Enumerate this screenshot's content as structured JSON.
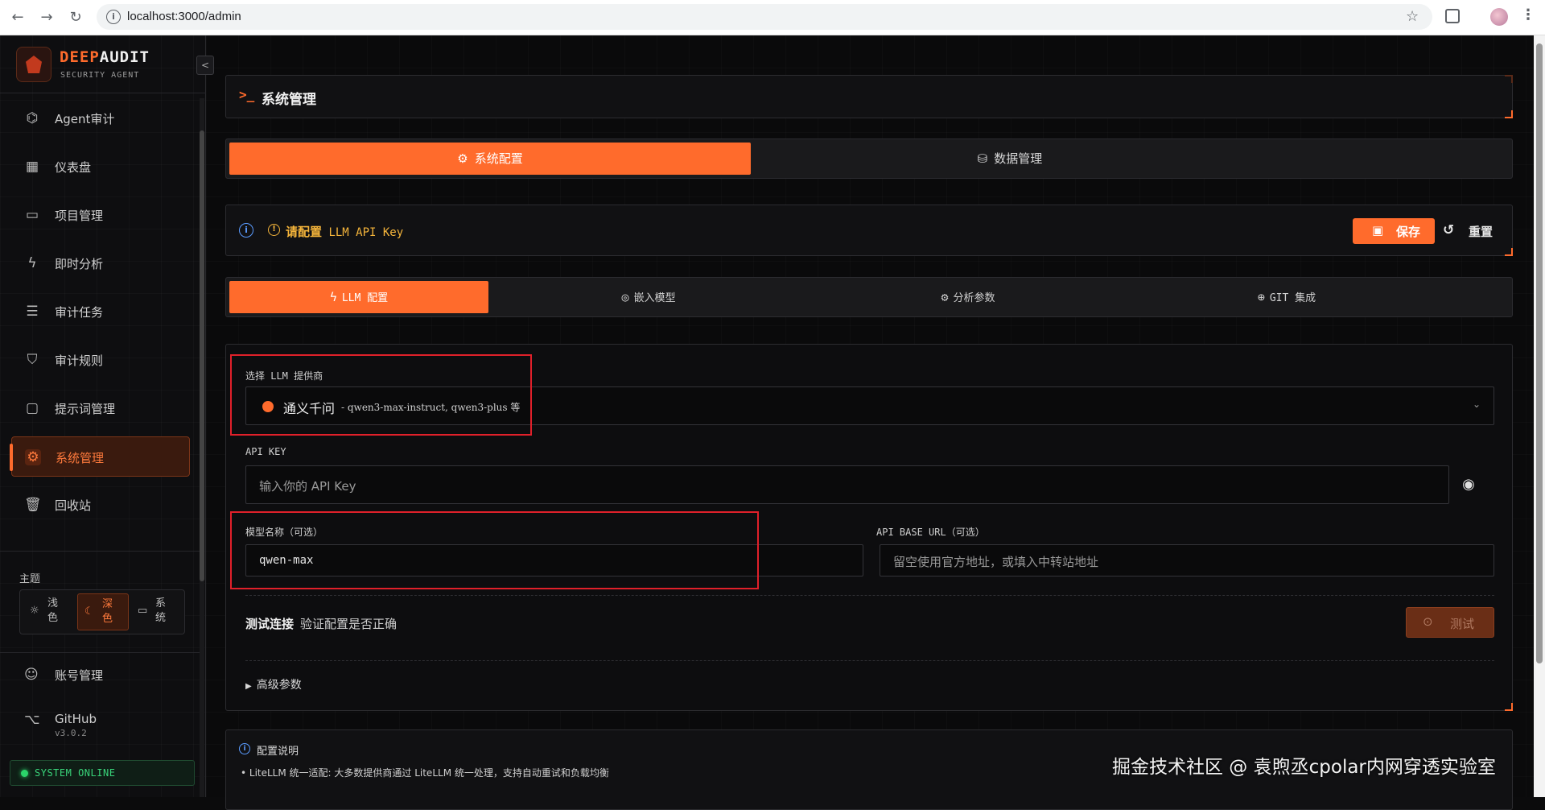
{
  "browser": {
    "back": "←",
    "forward": "→",
    "reload": "↻",
    "url": "localhost:3000/admin",
    "star": "☆",
    "menu": "⋮"
  },
  "brand": {
    "name_accent": "DEEP",
    "name_rest": "AUDIT",
    "subtitle": "SECURITY AGENT",
    "collapse_icon": "chevron-left-icon"
  },
  "sidebar": {
    "items": [
      {
        "label": "Agent审计",
        "icon": "robot-icon",
        "glyph": "⌬"
      },
      {
        "label": "仪表盘",
        "icon": "dashboard-icon",
        "glyph": "▦"
      },
      {
        "label": "项目管理",
        "icon": "folder-icon",
        "glyph": "▭"
      },
      {
        "label": "即时分析",
        "icon": "lightning-icon",
        "glyph": "ϟ"
      },
      {
        "label": "审计任务",
        "icon": "list-icon",
        "glyph": "☰"
      },
      {
        "label": "审计规则",
        "icon": "shield-icon",
        "glyph": "⛉"
      },
      {
        "label": "提示词管理",
        "icon": "message-icon",
        "glyph": "▢"
      },
      {
        "label": "系统管理",
        "icon": "gear-icon",
        "glyph": "⚙"
      },
      {
        "label": "回收站",
        "icon": "trash-icon",
        "glyph": "🗑"
      }
    ],
    "active_index": 7,
    "theme": {
      "title": "主题",
      "options": [
        {
          "label": "浅色",
          "icon": "sun-icon",
          "glyph": "☼"
        },
        {
          "label": "深色",
          "icon": "moon-icon",
          "glyph": "☾"
        },
        {
          "label": "系统",
          "icon": "monitor-icon",
          "glyph": "▭"
        }
      ],
      "active": 1
    },
    "account": {
      "label": "账号管理",
      "icon": "user-icon",
      "glyph": "☺"
    },
    "github": {
      "label": "GitHub",
      "version": "v3.0.2",
      "icon": "github-icon",
      "glyph": "⌥"
    },
    "status": "SYSTEM ONLINE"
  },
  "page": {
    "prompt": ">_",
    "title": "系统管理",
    "tabs": [
      {
        "label": "系统配置",
        "icon": "gear-icon",
        "glyph": "⚙"
      },
      {
        "label": "数据管理",
        "icon": "database-icon",
        "glyph": "⛁"
      }
    ],
    "active_tab": 0
  },
  "notice": {
    "warn_strong": "请配置",
    "warn_mono": " LLM API Key",
    "save": "保存",
    "reset": "重置"
  },
  "subtabs": [
    {
      "label": "LLM 配置",
      "icon": "lightning-icon",
      "glyph": "ϟ"
    },
    {
      "label": "嵌入模型",
      "icon": "brain-icon",
      "glyph": "◎"
    },
    {
      "label": "分析参数",
      "icon": "gear-icon",
      "glyph": "⚙"
    },
    {
      "label": "GIT 集成",
      "icon": "globe-icon",
      "glyph": "⊕"
    }
  ],
  "form": {
    "provider_label": "选择 LLM 提供商",
    "provider_name": "通义千问",
    "provider_desc": "- qwen3-max-instruct, qwen3-plus 等",
    "api_key_label": "API KEY",
    "api_key_placeholder": "输入你的 API Key",
    "model_label": "模型名称（可选）",
    "model_value": "qwen-max",
    "base_url_label": "API BASE URL（可选）",
    "base_url_placeholder": "留空使用官方地址，或填入中转站地址",
    "test_title": "测试连接",
    "test_sub": "验证配置是否正确",
    "test_button": "测试",
    "advanced": "高级参数"
  },
  "notes": {
    "title": "配置说明",
    "line1": "• LiteLLM 统一适配: 大多数提供商通过 LiteLLM 统一处理，支持自动重试和负载均衡"
  },
  "watermark": "掘金技术社区 @ 袁煦丞cpolar内网穿透实验室",
  "colors": {
    "accent": "#ff6b2c",
    "online": "#2bd46a",
    "warning": "#f5b53b",
    "highlight_box": "#e0202a"
  }
}
